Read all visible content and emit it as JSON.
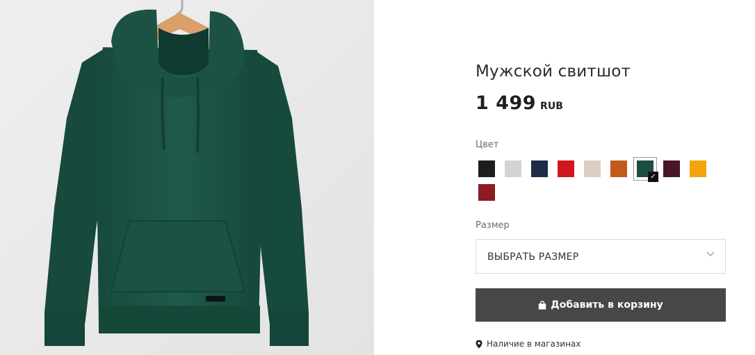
{
  "product": {
    "title": "Мужской свитшот",
    "price": "1 499",
    "currency": "RUB",
    "image_icon": "green-hoodie-photo"
  },
  "color": {
    "label": "Цвет",
    "selected_index": 6,
    "swatches": [
      {
        "name": "black",
        "hex": "#1d1d1f"
      },
      {
        "name": "light-grey-melange",
        "hex": "#d3d3d6"
      },
      {
        "name": "navy",
        "hex": "#1e2a46"
      },
      {
        "name": "red",
        "hex": "#d0161f"
      },
      {
        "name": "beige",
        "hex": "#dccdc3"
      },
      {
        "name": "rust",
        "hex": "#c25a1a"
      },
      {
        "name": "dark-green",
        "hex": "#1b4d43"
      },
      {
        "name": "burgundy-dark",
        "hex": "#4a1626"
      },
      {
        "name": "yellow",
        "hex": "#f2a40a"
      },
      {
        "name": "wine",
        "hex": "#8e1a22"
      }
    ]
  },
  "size": {
    "label": "Размер",
    "placeholder": "ВЫБРАТЬ РАЗМЕР"
  },
  "cart": {
    "add_label": "Добавить в корзину"
  },
  "stores": {
    "label": "Наличие в магазинах"
  },
  "colors": {
    "button_bg": "#474747",
    "image_bg": "#ebebeb",
    "hoodie": "#1d5446"
  }
}
